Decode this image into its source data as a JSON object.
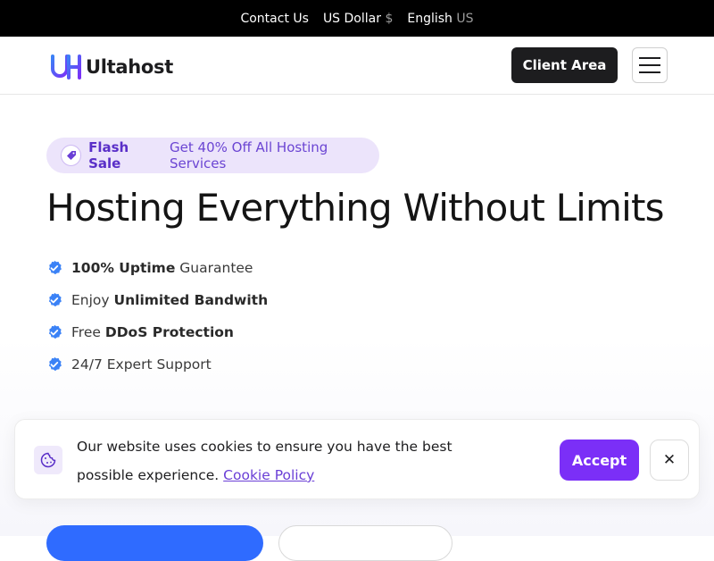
{
  "topbar": {
    "contact": "Contact Us",
    "currency_label": "US Dollar",
    "currency_symbol": "$",
    "language_label": "English",
    "language_code": "US"
  },
  "header": {
    "logo_text": "Ultahost",
    "client_area_label": "Client Area",
    "menu_icon": "hamburger-icon"
  },
  "hero": {
    "flash_label": "Flash Sale",
    "flash_text": "Get 40% Off All Hosting Services",
    "title": "Hosting Everything Without Limits",
    "features": [
      {
        "bold": "100% Uptime",
        "rest": " Guarantee",
        "bold_first": true
      },
      {
        "pre": "Enjoy ",
        "bold": "Unlimited Bandwith",
        "bold_first": false
      },
      {
        "pre": "Free ",
        "bold": "DDoS Protection",
        "bold_first": false
      },
      {
        "pre": "24/7 Expert Support",
        "bold": "",
        "bold_first": false
      }
    ]
  },
  "cookie": {
    "text": "Our website uses cookies to ensure you have the best possible experience.",
    "link": "Cookie Policy",
    "accept_label": "Accept",
    "close_label": "✕"
  },
  "colors": {
    "accent_purple": "#7b2ff7",
    "check_blue": "#3b82f6",
    "primary_blue": "#2f6bff"
  }
}
